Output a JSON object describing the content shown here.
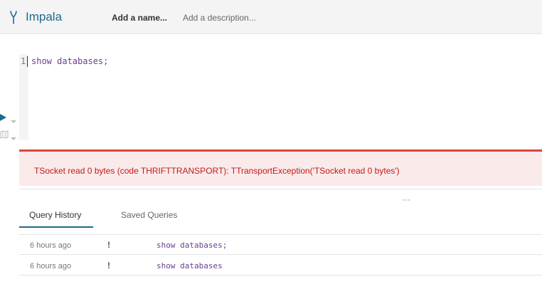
{
  "header": {
    "app_icon": "impala-icon",
    "app_title": "Impala",
    "name_placeholder": "Add a name...",
    "description_placeholder": "Add a description..."
  },
  "editor": {
    "line_number": "1",
    "code": "show databases;",
    "run_icon": "play-icon",
    "map_icon": "map-icon"
  },
  "error": {
    "message": "TSocket read 0 bytes (code THRIFTTRANSPORT): TTransportException('TSocket read 0 bytes')"
  },
  "tabs": [
    {
      "label": "Query History",
      "active": true
    },
    {
      "label": "Saved Queries",
      "active": false
    }
  ],
  "history": [
    {
      "time": "6 hours ago",
      "status": "!",
      "query": "show databases;"
    },
    {
      "time": "6 hours ago",
      "status": "!",
      "query": "show databases"
    }
  ],
  "colors": {
    "accent": "#1d6a8f",
    "error_border": "#d9443d",
    "error_bg": "#fbeaea",
    "error_text": "#c01a1a",
    "code": "#6a3e8f"
  }
}
